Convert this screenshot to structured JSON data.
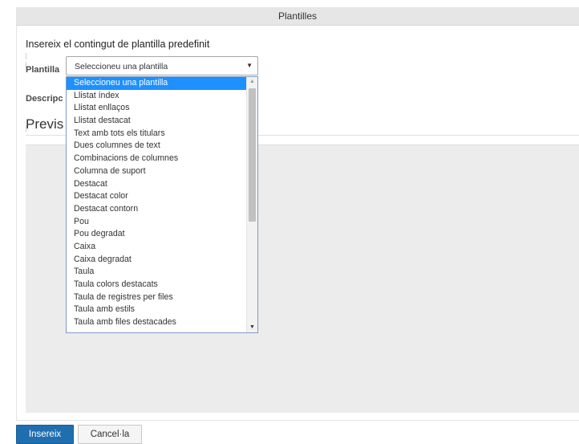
{
  "dialog": {
    "title": "Plantilles",
    "intro": "Insereix el contingut de plantilla predefinit",
    "template_label": "Plantilla",
    "description_label": "Descripc",
    "preview_label": "Previs"
  },
  "template_select": {
    "value": "Seleccioneu una plantilla",
    "options": [
      "Seleccioneu una plantilla",
      "Llistat índex",
      "Llistat enllaços",
      "Llistat destacat",
      "Text amb tots els titulars",
      "Dues columnes de text",
      "Combinacions de columnes",
      "Columna de suport",
      "Destacat",
      "Destacat color",
      "Destacat contorn",
      "Pou",
      "Pou degradat",
      "Caixa",
      "Caixa degradat",
      "Taula",
      "Taula colors destacats",
      "Taula de registres per files",
      "Taula amb estils",
      "Taula amb files destacades"
    ]
  },
  "buttons": {
    "insert": "Insereix",
    "cancel": "Cancel·la"
  },
  "colors": {
    "selected_option": "#1e90ff",
    "primary_button": "#1f6fb0",
    "title_bar": "#e6e6e6",
    "preview_background": "#ececec"
  }
}
